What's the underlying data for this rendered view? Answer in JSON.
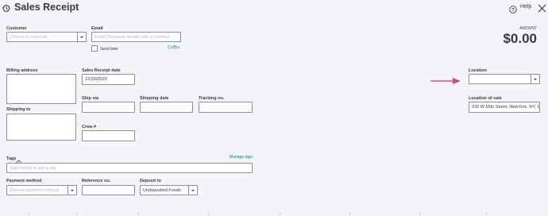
{
  "header": {
    "title": "Sales Receipt",
    "help_label": "Help"
  },
  "customer": {
    "label": "Customer",
    "placeholder": "Choose a customer"
  },
  "email": {
    "label": "Email",
    "placeholder": "Email (Separate emails with a comma)",
    "send_later_label": "Send later",
    "send_later_checked": false,
    "cc_bcc_label": "Cc/Bcc"
  },
  "amount": {
    "label": "AMOUNT",
    "value": "$0.00"
  },
  "billing_address": {
    "label": "Billing address"
  },
  "sales_receipt_date": {
    "label": "Sales Receipt date",
    "value": "12/26/2020"
  },
  "ship_via": {
    "label": "Ship via"
  },
  "shipping_date": {
    "label": "Shipping date"
  },
  "tracking_no": {
    "label": "Tracking no."
  },
  "shipping_to": {
    "label": "Shipping to"
  },
  "crew": {
    "label": "Crew #"
  },
  "location": {
    "label": "Location",
    "value": ""
  },
  "location_of_sale": {
    "label": "Location of sale",
    "value": "230 W 55th Street, NewYork, NY, 1"
  },
  "tags": {
    "label": "Tags",
    "manage_label": "Manage tags",
    "placeholder": "Start typing to add a tag"
  },
  "payment_method": {
    "label": "Payment method",
    "placeholder": "Choose payment method"
  },
  "reference_no": {
    "label": "Reference no."
  },
  "deposit_to": {
    "label": "Deposit to",
    "value": "Undeposited Funds"
  },
  "colors": {
    "arrow": "#e0427a",
    "link": "#0077c5",
    "background": "#f4f5f8"
  }
}
